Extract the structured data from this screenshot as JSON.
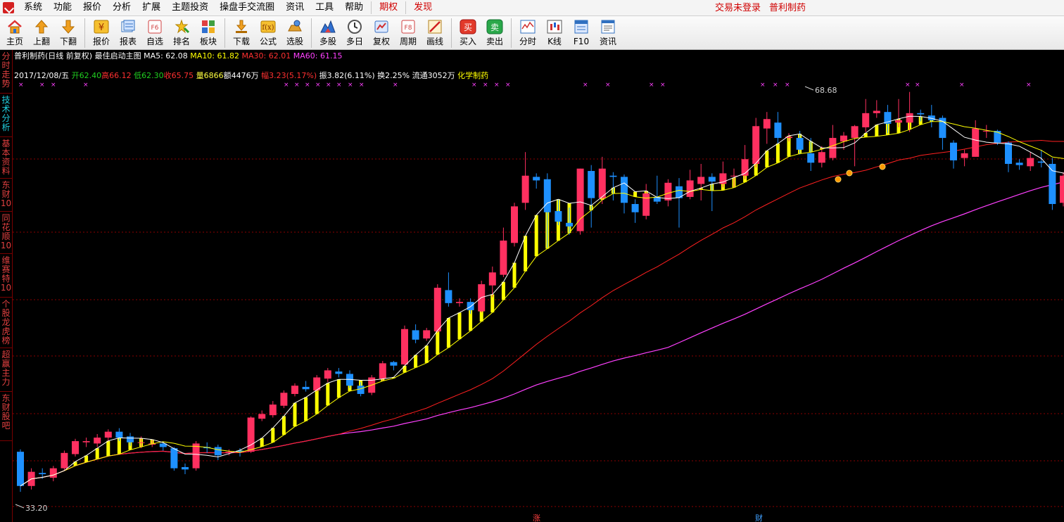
{
  "menubar": {
    "items": [
      "系统",
      "功能",
      "报价",
      "分析",
      "扩展",
      "主题投资",
      "操盘手交流圈",
      "资讯",
      "工具",
      "帮助"
    ],
    "highlighted": [
      "期权",
      "发现"
    ],
    "login_status": "交易未登录",
    "current_stock": "普利制药"
  },
  "toolbar": {
    "buttons": [
      {
        "label": "主页",
        "icon": "home-icon"
      },
      {
        "label": "上翻",
        "icon": "arrow-up-icon"
      },
      {
        "label": "下翻",
        "icon": "arrow-down-icon"
      },
      {
        "label": "报价",
        "icon": "yen-icon"
      },
      {
        "label": "报表",
        "icon": "report-icon"
      },
      {
        "label": "自选",
        "icon": "f6-icon"
      },
      {
        "label": "排名",
        "icon": "ranking-icon"
      },
      {
        "label": "板块",
        "icon": "sector-icon"
      },
      {
        "label": "下载",
        "icon": "download-icon"
      },
      {
        "label": "公式",
        "icon": "formula-icon"
      },
      {
        "label": "选股",
        "icon": "stock-picker-icon"
      },
      {
        "label": "多股",
        "icon": "multi-stock-icon"
      },
      {
        "label": "多日",
        "icon": "clock-icon"
      },
      {
        "label": "复权",
        "icon": "adjust-icon"
      },
      {
        "label": "周期",
        "icon": "f8-icon"
      },
      {
        "label": "画线",
        "icon": "draw-line-icon"
      },
      {
        "label": "买入",
        "icon": "buy-icon",
        "glyph": "买"
      },
      {
        "label": "卖出",
        "icon": "sell-icon",
        "glyph": "卖"
      },
      {
        "label": "分时",
        "icon": "timeshare-icon"
      },
      {
        "label": "K线",
        "icon": "kline-icon"
      },
      {
        "label": "F10",
        "icon": "f10-icon"
      },
      {
        "label": "资讯",
        "icon": "news-icon"
      }
    ]
  },
  "left_tabs": [
    {
      "label": "分时走势",
      "active": false
    },
    {
      "label": "技术分析",
      "active": true
    },
    {
      "label": "基本资料",
      "active": false
    },
    {
      "label": "东财10",
      "active": false
    },
    {
      "label": "同花顺10",
      "active": false
    },
    {
      "label": "维赛特10",
      "active": false
    },
    {
      "label": "个股龙虎榜",
      "active": false
    },
    {
      "label": "超赢主力",
      "active": false
    },
    {
      "label": "东财股吧",
      "active": false
    }
  ],
  "chart_header": {
    "title": "普利制药(日线 前复权) 最佳启动主图",
    "ma5": "MA5: 62.08",
    "ma10": "MA10: 61.82",
    "ma30": "MA30: 62.01",
    "ma60": "MA60: 61.15"
  },
  "quote_bar": {
    "date": "2017/12/08/五",
    "open": "开62.40",
    "high": "高66.12",
    "low": "低62.30",
    "close": "收65.75",
    "volume": "量6866",
    "amount": "额4476万",
    "change": "幅3.23(5.17%)",
    "amplitude": "振3.82(6.11%)",
    "turnover": "换2.25%",
    "float_shares": "流通3052万",
    "industry": "化学制药"
  },
  "annotations": {
    "max_label": "68.68",
    "min_label": "33.20",
    "bottom_mark_1": "涨",
    "bottom_mark_2": "财"
  },
  "colors": {
    "up": "#ff3060",
    "down": "#1e90ff",
    "ma5": "#ffffff",
    "ma10": "#ffff00",
    "ma30": "#ff2020",
    "ma60": "#ff40ff",
    "grid": "#8b0000",
    "band": "#ffff00"
  },
  "chart_data": {
    "type": "candlestick",
    "title": "普利制药(日线 前复权) 最佳启动主图",
    "ylim": [
      33.2,
      68.68
    ],
    "candles": [
      [
        38.2,
        35.3,
        38.4,
        34.8
      ],
      [
        35.3,
        36.5,
        36.8,
        35.0
      ],
      [
        36.4,
        36.3,
        36.8,
        35.9
      ],
      [
        36.0,
        36.8,
        37.0,
        35.7
      ],
      [
        36.8,
        38.1,
        38.3,
        36.6
      ],
      [
        38.0,
        39.1,
        39.3,
        37.8
      ],
      [
        39.0,
        39.1,
        39.4,
        38.6
      ],
      [
        38.9,
        39.4,
        39.7,
        38.6
      ],
      [
        39.4,
        39.9,
        40.1,
        39.1
      ],
      [
        39.9,
        39.4,
        40.2,
        39.1
      ],
      [
        39.5,
        39.0,
        39.8,
        38.7
      ],
      [
        39.0,
        39.0,
        39.5,
        38.5
      ],
      [
        38.8,
        38.9,
        39.2,
        38.6
      ],
      [
        38.9,
        38.6,
        39.1,
        38.3
      ],
      [
        38.5,
        36.8,
        38.6,
        36.6
      ],
      [
        36.9,
        36.7,
        37.2,
        36.3
      ],
      [
        36.8,
        38.9,
        39.1,
        36.6
      ],
      [
        38.6,
        38.5,
        39.0,
        38.1
      ],
      [
        38.6,
        37.9,
        38.8,
        37.5
      ],
      [
        38.1,
        38.2,
        38.4,
        37.9
      ],
      [
        38.3,
        38.2,
        38.5,
        37.8
      ],
      [
        38.2,
        41.1,
        41.2,
        38.1
      ],
      [
        41.0,
        41.4,
        41.7,
        40.8
      ],
      [
        41.3,
        42.2,
        42.5,
        41.1
      ],
      [
        42.1,
        43.2,
        43.4,
        41.9
      ],
      [
        43.1,
        43.8,
        44.0,
        42.9
      ],
      [
        43.7,
        43.5,
        44.2,
        43.3
      ],
      [
        43.4,
        44.5,
        44.7,
        43.3
      ],
      [
        44.4,
        45.1,
        45.3,
        44.1
      ],
      [
        45.0,
        44.8,
        45.3,
        44.5
      ],
      [
        44.8,
        43.8,
        45.1,
        43.6
      ],
      [
        43.8,
        43.1,
        44.1,
        42.9
      ],
      [
        43.2,
        44.5,
        44.7,
        43.0
      ],
      [
        44.4,
        45.7,
        45.9,
        44.2
      ],
      [
        45.8,
        45.5,
        45.9,
        45.1
      ],
      [
        45.6,
        48.6,
        48.9,
        45.5
      ],
      [
        48.5,
        47.7,
        49.0,
        47.4
      ],
      [
        47.8,
        48.5,
        48.7,
        47.6
      ],
      [
        48.4,
        52.1,
        52.4,
        48.3
      ],
      [
        51.9,
        50.8,
        53.4,
        50.5
      ],
      [
        50.8,
        50.9,
        51.2,
        50.5
      ],
      [
        50.9,
        50.2,
        51.2,
        49.9
      ],
      [
        50.1,
        52.4,
        52.7,
        50.0
      ],
      [
        52.3,
        53.4,
        53.9,
        51.3
      ],
      [
        53.2,
        56.1,
        57.2,
        53.0
      ],
      [
        55.9,
        59.0,
        59.3,
        55.6
      ],
      [
        59.3,
        61.6,
        63.6,
        58.7
      ],
      [
        61.5,
        61.2,
        61.8,
        60.5
      ],
      [
        61.3,
        58.5,
        61.8,
        55.5
      ],
      [
        58.6,
        57.7,
        59.6,
        57.4
      ],
      [
        57.6,
        57.3,
        58.9,
        56.6
      ],
      [
        56.9,
        62.2,
        62.2,
        56.6
      ],
      [
        62.0,
        59.7,
        62.5,
        57.2
      ],
      [
        59.7,
        62.2,
        63.2,
        59.2
      ],
      [
        61.6,
        61.5,
        61.9,
        59.5
      ],
      [
        61.5,
        59.3,
        61.7,
        58.4
      ],
      [
        59.2,
        58.5,
        59.6,
        57.6
      ],
      [
        58.2,
        60.1,
        60.9,
        57.9
      ],
      [
        59.8,
        59.4,
        61.6,
        59.2
      ],
      [
        59.5,
        61.0,
        61.3,
        59.0
      ],
      [
        60.7,
        59.7,
        61.4,
        57.2
      ],
      [
        59.8,
        61.2,
        62.1,
        59.6
      ],
      [
        60.9,
        61.5,
        62.6,
        59.5
      ],
      [
        61.5,
        61.1,
        61.8,
        58.6
      ],
      [
        60.9,
        61.8,
        62.8,
        60.6
      ],
      [
        61.6,
        61.6,
        62.2,
        60.6
      ],
      [
        61.6,
        63.0,
        64.2,
        61.3
      ],
      [
        62.6,
        65.8,
        66.5,
        62.3
      ],
      [
        65.6,
        66.4,
        67.0,
        64.3
      ],
      [
        66.1,
        64.8,
        67.0,
        64.3
      ],
      [
        64.8,
        64.9,
        65.2,
        64.5
      ],
      [
        64.8,
        63.8,
        65.4,
        63.4
      ],
      [
        63.5,
        62.7,
        64.8,
        62.0
      ],
      [
        62.7,
        63.6,
        64.1,
        62.3
      ],
      [
        63.1,
        64.8,
        65.9,
        62.9
      ],
      [
        64.5,
        65.0,
        65.3,
        63.8
      ],
      [
        64.8,
        65.8,
        65.9,
        62.4
      ],
      [
        65.7,
        66.9,
        68.1,
        65.3
      ],
      [
        66.9,
        67.1,
        68.0,
        66.5
      ],
      [
        67.0,
        66.0,
        67.6,
        65.2
      ],
      [
        66.1,
        66.3,
        68.1,
        65.7
      ],
      [
        66.1,
        66.9,
        68.7,
        65.3
      ],
      [
        66.9,
        66.8,
        67.2,
        66.2
      ],
      [
        66.7,
        66.3,
        67.6,
        65.7
      ],
      [
        66.5,
        64.8,
        66.7,
        63.8
      ],
      [
        64.4,
        62.9,
        64.6,
        62.2
      ],
      [
        63.1,
        63.5,
        63.8,
        62.4
      ],
      [
        63.2,
        65.6,
        66.3,
        63.2
      ],
      [
        65.4,
        65.4,
        65.9,
        64.8
      ],
      [
        65.4,
        64.4,
        65.5,
        64.2
      ],
      [
        64.4,
        62.6,
        64.5,
        61.9
      ],
      [
        62.7,
        62.5,
        63.0,
        62.1
      ],
      [
        62.4,
        63.1,
        63.6,
        62.0
      ],
      [
        62.8,
        62.7,
        63.8,
        62.3
      ],
      [
        62.6,
        59.2,
        63.1,
        58.7
      ],
      [
        59.3,
        61.6,
        61.9,
        59.0
      ],
      [
        61.3,
        60.8,
        64.4,
        60.4
      ],
      [
        60.5,
        60.3,
        61.4,
        59.6
      ],
      [
        60.4,
        59.3,
        61.0,
        57.9
      ],
      [
        59.5,
        56.6,
        60.3,
        56.5
      ],
      [
        56.5,
        56.4,
        57.5,
        55.8
      ],
      [
        56.3,
        57.0,
        57.6,
        56.3
      ],
      [
        56.6,
        61.2,
        61.6,
        56.5
      ],
      [
        61.2,
        60.3,
        62.0,
        59.2
      ],
      [
        60.0,
        60.6,
        61.2,
        59.7
      ],
      [
        60.3,
        60.6,
        61.3,
        60.1
      ],
      [
        60.4,
        61.2,
        61.6,
        60.2
      ],
      [
        61.1,
        64.1,
        65.2,
        60.9
      ],
      [
        63.9,
        63.4,
        64.5,
        63.1
      ]
    ]
  }
}
